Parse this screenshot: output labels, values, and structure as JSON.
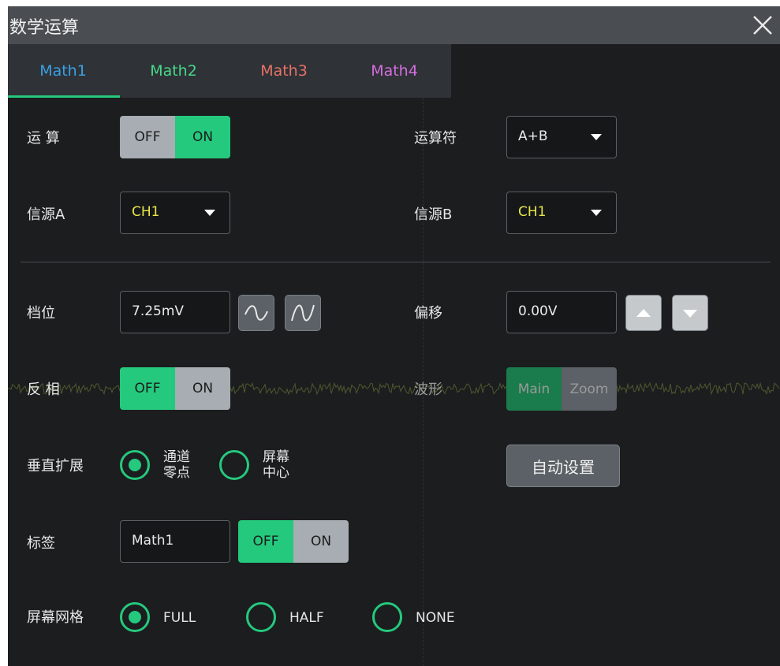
{
  "window": {
    "title": "数学运算",
    "close_icon": "close-icon"
  },
  "tabs": [
    {
      "label": "Math1",
      "color": "#3aa0e6",
      "active": true
    },
    {
      "label": "Math2",
      "color": "#46d98c",
      "active": false
    },
    {
      "label": "Math3",
      "color": "#e57368",
      "active": false
    },
    {
      "label": "Math4",
      "color": "#d46ee0",
      "active": false
    }
  ],
  "accent_color": "#24c97d",
  "operation": {
    "label": "运 算",
    "off": "OFF",
    "on": "ON",
    "value": "ON"
  },
  "operator": {
    "label": "运算符",
    "value": "A+B"
  },
  "source_a": {
    "label": "信源A",
    "value": "CH1",
    "color": "#e8e64a"
  },
  "source_b": {
    "label": "信源B",
    "value": "CH1",
    "color": "#e8e64a"
  },
  "scale": {
    "label": "档位",
    "value": "7.25mV",
    "icons": [
      "coarse-adjust-icon",
      "fine-adjust-icon"
    ]
  },
  "offset": {
    "label": "偏移",
    "value": "0.00V",
    "icons": [
      "arrow-up-icon",
      "arrow-down-icon"
    ]
  },
  "invert": {
    "label": "反 相",
    "off": "OFF",
    "on": "ON",
    "value": "OFF"
  },
  "waveform": {
    "label": "波形",
    "main": "Main",
    "zoom": "Zoom",
    "value": "Main"
  },
  "vertical_expand": {
    "label": "垂直扩展",
    "options": [
      {
        "line1": "通道",
        "line2": "零点",
        "selected": true
      },
      {
        "line1": "屏幕",
        "line2": "中心",
        "selected": false
      }
    ]
  },
  "autoset": {
    "label": "自动设置"
  },
  "tag": {
    "label": "标签",
    "value": "Math1",
    "off": "OFF",
    "on": "ON",
    "toggle_value": "OFF"
  },
  "grid": {
    "label": "屏幕网格",
    "options": [
      {
        "label": "FULL",
        "selected": true
      },
      {
        "label": "HALF",
        "selected": false
      },
      {
        "label": "NONE",
        "selected": false
      }
    ]
  }
}
